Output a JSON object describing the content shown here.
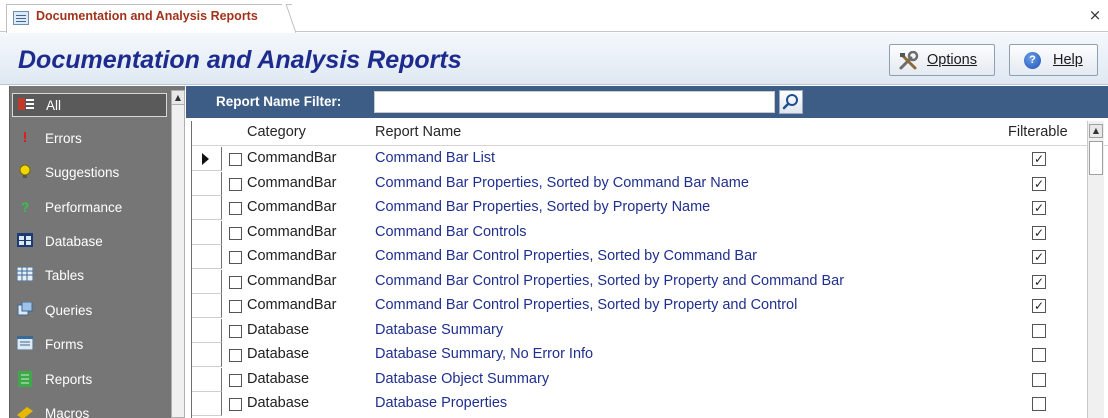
{
  "tab": {
    "title": "Documentation and Analysis Reports",
    "close_glyph": "×"
  },
  "header": {
    "title": "Documentation and Analysis Reports",
    "options_label": "Options",
    "help_label": "Help"
  },
  "filter": {
    "label": "Report Name Filter:",
    "value": "",
    "placeholder": ""
  },
  "sidebar": {
    "items": [
      {
        "label": "All",
        "icon": "all-reports-icon",
        "active": true
      },
      {
        "label": "Errors",
        "icon": "exclamation-icon"
      },
      {
        "label": "Suggestions",
        "icon": "lightbulb-icon"
      },
      {
        "label": "Performance",
        "icon": "question-icon"
      },
      {
        "label": "Database",
        "icon": "database-icon"
      },
      {
        "label": "Tables",
        "icon": "table-icon"
      },
      {
        "label": "Queries",
        "icon": "query-icon"
      },
      {
        "label": "Forms",
        "icon": "form-icon"
      },
      {
        "label": "Reports",
        "icon": "report-icon"
      },
      {
        "label": "Macros",
        "icon": "macro-icon"
      }
    ]
  },
  "grid": {
    "columns": [
      "Category",
      "Report Name",
      "Filterable"
    ],
    "rows": [
      {
        "category": "CommandBar",
        "name": "Command Bar List",
        "filterable": true,
        "current": true
      },
      {
        "category": "CommandBar",
        "name": "Command Bar Properties, Sorted by Command Bar Name",
        "filterable": true
      },
      {
        "category": "CommandBar",
        "name": "Command Bar Properties, Sorted by Property Name",
        "filterable": true
      },
      {
        "category": "CommandBar",
        "name": "Command Bar Controls",
        "filterable": true
      },
      {
        "category": "CommandBar",
        "name": "Command Bar Control Properties, Sorted by Command Bar",
        "filterable": true
      },
      {
        "category": "CommandBar",
        "name": "Command Bar Control Properties, Sorted by Property and Command Bar",
        "filterable": true
      },
      {
        "category": "CommandBar",
        "name": "Command Bar Control Properties, Sorted by Property and Control",
        "filterable": true
      },
      {
        "category": "Database",
        "name": "Database Summary",
        "filterable": false
      },
      {
        "category": "Database",
        "name": "Database Summary, No Error Info",
        "filterable": false
      },
      {
        "category": "Database",
        "name": "Database Object Summary",
        "filterable": false
      },
      {
        "category": "Database",
        "name": "Database Properties",
        "filterable": false
      }
    ]
  },
  "colors": {
    "title": "#1d2b8f",
    "tab_label": "#a1331b",
    "filter_bar": "#3d5d86",
    "sidebar": "#767676",
    "link": "#1f2f8f"
  }
}
